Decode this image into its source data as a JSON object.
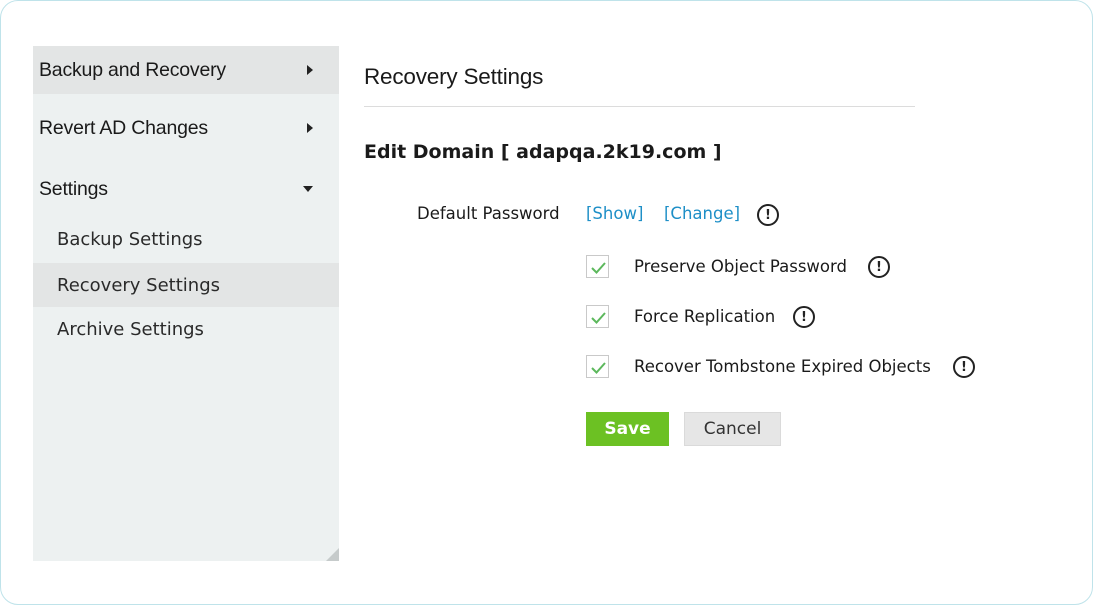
{
  "sidebar": {
    "sections": [
      {
        "label": "Backup and Recovery",
        "expanded": false
      },
      {
        "label": "Revert AD Changes",
        "expanded": false
      },
      {
        "label": "Settings",
        "expanded": true
      }
    ],
    "sub_items": [
      {
        "label": "Backup Settings",
        "selected": false
      },
      {
        "label": "Recovery Settings",
        "selected": true
      },
      {
        "label": "Archive Settings",
        "selected": false
      }
    ]
  },
  "main": {
    "title": "Recovery Settings",
    "heading": "Edit Domain [ adapqa.2k19.com ]",
    "default_password": {
      "label": "Default Password",
      "show_link": "[Show]",
      "change_link": "[Change]"
    },
    "options": [
      {
        "label": "Preserve Object Password",
        "checked": true
      },
      {
        "label": "Force Replication",
        "checked": true
      },
      {
        "label": "Recover Tombstone Expired Objects",
        "checked": true
      }
    ],
    "save_label": "Save",
    "cancel_label": "Cancel"
  },
  "icons": {
    "info": "info-icon",
    "check": "checkmark-icon",
    "arrow_right": "chevron-right-icon",
    "arrow_down": "chevron-down-icon"
  },
  "colors": {
    "accent_green": "#6cc123",
    "link_blue": "#1e8fc7",
    "sidebar_bg": "#edf1f1",
    "selected_bg": "#e3e5e5",
    "check_green": "#5cb85c"
  }
}
